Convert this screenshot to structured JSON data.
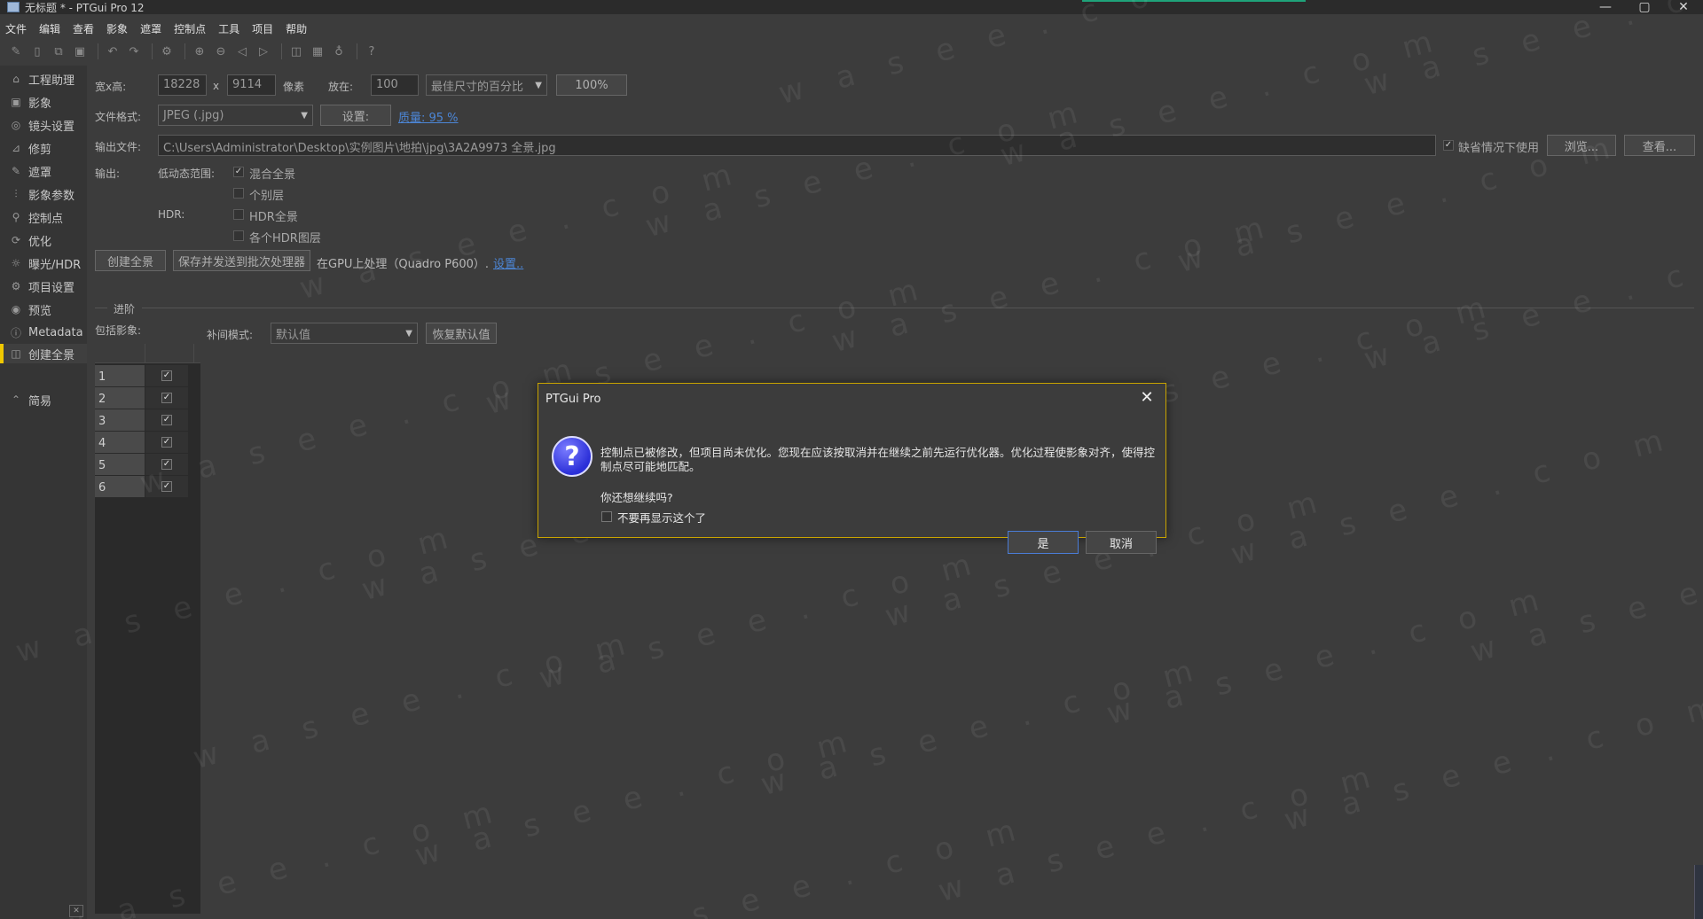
{
  "window": {
    "title": "无标题 * - PTGui Pro 12",
    "controls": {
      "minimize": "—",
      "maximize": "▢",
      "close": "✕"
    }
  },
  "menu": [
    "文件",
    "编辑",
    "查看",
    "影象",
    "遮罩",
    "控制点",
    "工具",
    "项目",
    "帮助"
  ],
  "toolbar_icons": [
    "new-project-icon",
    "open-icon",
    "save-copy-icon",
    "save-icon",
    "undo-icon",
    "redo-icon",
    "settings-gear-icon",
    "zoom-in-icon",
    "zoom-out-icon",
    "prev-icon",
    "next-icon",
    "panorama-editor-icon",
    "grid-icon",
    "lightbulb-icon",
    "help-icon"
  ],
  "sidebar": {
    "items": [
      {
        "label": "工程助理",
        "icon": "⌂"
      },
      {
        "label": "影象",
        "icon": "▣"
      },
      {
        "label": "镜头设置",
        "icon": "◎"
      },
      {
        "label": "修剪",
        "icon": "⊿"
      },
      {
        "label": "遮罩",
        "icon": "✎"
      },
      {
        "label": "影象参数",
        "icon": "⫶"
      },
      {
        "label": "控制点",
        "icon": "⚲"
      },
      {
        "label": "优化",
        "icon": "⟳"
      },
      {
        "label": "曝光/HDR",
        "icon": "☼"
      },
      {
        "label": "项目设置",
        "icon": "⚙"
      },
      {
        "label": "预览",
        "icon": "◉"
      },
      {
        "label": "Metadata",
        "icon": "ⓘ"
      },
      {
        "label": "创建全景",
        "icon": "◫"
      }
    ],
    "simple_label": "简易",
    "simple_icon": "⌃",
    "collapse_icon": "✕"
  },
  "form": {
    "size_label": "宽x高:",
    "width_value": "18228",
    "times": "x",
    "height_value": "9114",
    "pixels_label": "像素",
    "scale_label": "放在:",
    "scale_value": "100",
    "scale_mode": "最佳尺寸的百分比",
    "percent_button": "100%",
    "format_label": "文件格式:",
    "format_value": "JPEG (.jpg)",
    "format_settings_button": "设置:",
    "quality_link": "质量: 95 %",
    "output_file_label": "输出文件:",
    "output_file_value": "C:\\Users\\Administrator\\Desktop\\实例图片\\地拍\\jpg\\3A2A9973 全景.jpg",
    "use_default_label": "缺省情况下使用",
    "use_default_checked": "✓",
    "browse_button": "浏览...",
    "view_button": "查看...",
    "output_label": "输出:",
    "ldr_label": "低动态范围:",
    "blended_label": "混合全景",
    "blended_checked": "✓",
    "layers_label": "个别层",
    "hdr_label": "HDR:",
    "hdr_pano_label": "HDR全景",
    "hdr_layers_label": "各个HDR图层",
    "create_button": "创建全景",
    "save_batch_button": "保存并发送到批次处理器",
    "gpu_text": "在GPU上处理（Quadro P600）.",
    "gpu_settings_link": "设置..",
    "advanced_label": "进阶",
    "include_images_label": "包括影象:",
    "interp_label": "补间模式:",
    "interp_value": "默认值",
    "restore_default_button": "恢复默认值"
  },
  "image_table": {
    "rows": [
      {
        "num": "1",
        "checked": "✓"
      },
      {
        "num": "2",
        "checked": "✓"
      },
      {
        "num": "3",
        "checked": "✓"
      },
      {
        "num": "4",
        "checked": "✓"
      },
      {
        "num": "5",
        "checked": "✓"
      },
      {
        "num": "6",
        "checked": "✓"
      }
    ]
  },
  "dialog": {
    "title": "PTGui Pro",
    "close": "✕",
    "icon": "?",
    "message": "控制点已被修改，但项目尚未优化。您现在应该按取消并在继续之前先运行优化器。优化过程使影象对齐，使得控制点尽可能地匹配。",
    "question": "你还想继续吗?",
    "dont_show": "不要再显示这个了",
    "yes": "是",
    "cancel": "取消"
  },
  "watermark": "w a s e e . c o m"
}
